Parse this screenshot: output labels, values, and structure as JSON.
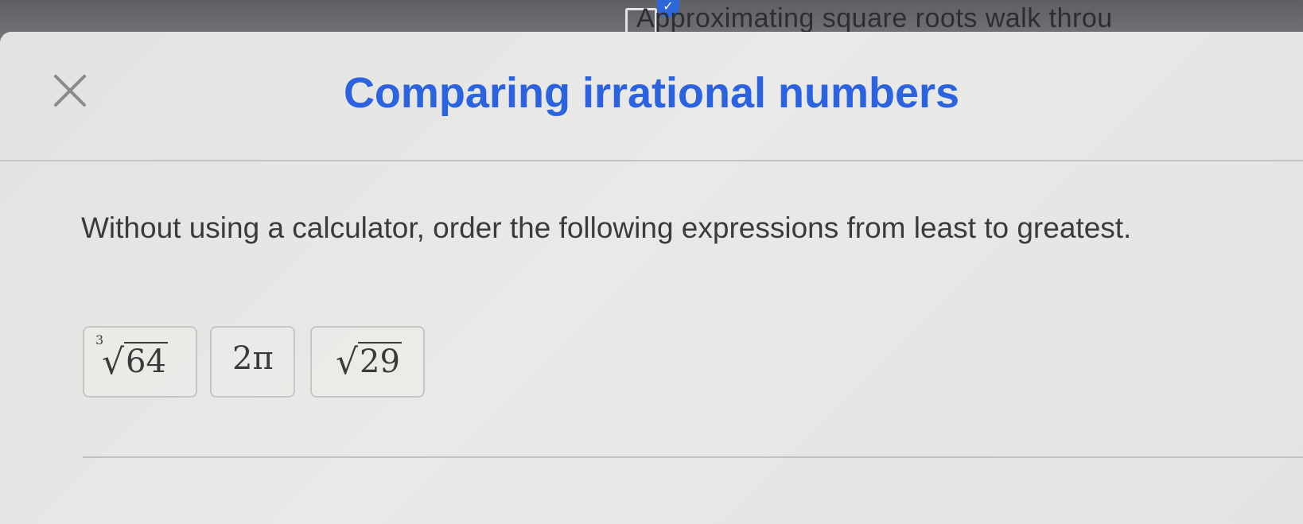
{
  "background": {
    "window_title": "Approximating square roots walk throu"
  },
  "modal": {
    "title": "Comparing irrational numbers",
    "prompt": "Without using a calculator, order the following expressions from least to greatest.",
    "expressions": [
      {
        "index": "3",
        "radicand": "64",
        "text": ""
      },
      {
        "index": "",
        "radicand": "",
        "text": "2π"
      },
      {
        "index": "",
        "radicand": "29",
        "text": ""
      }
    ]
  },
  "colors": {
    "title_blue": "#2a62e0",
    "text": "#3b3b3b"
  }
}
